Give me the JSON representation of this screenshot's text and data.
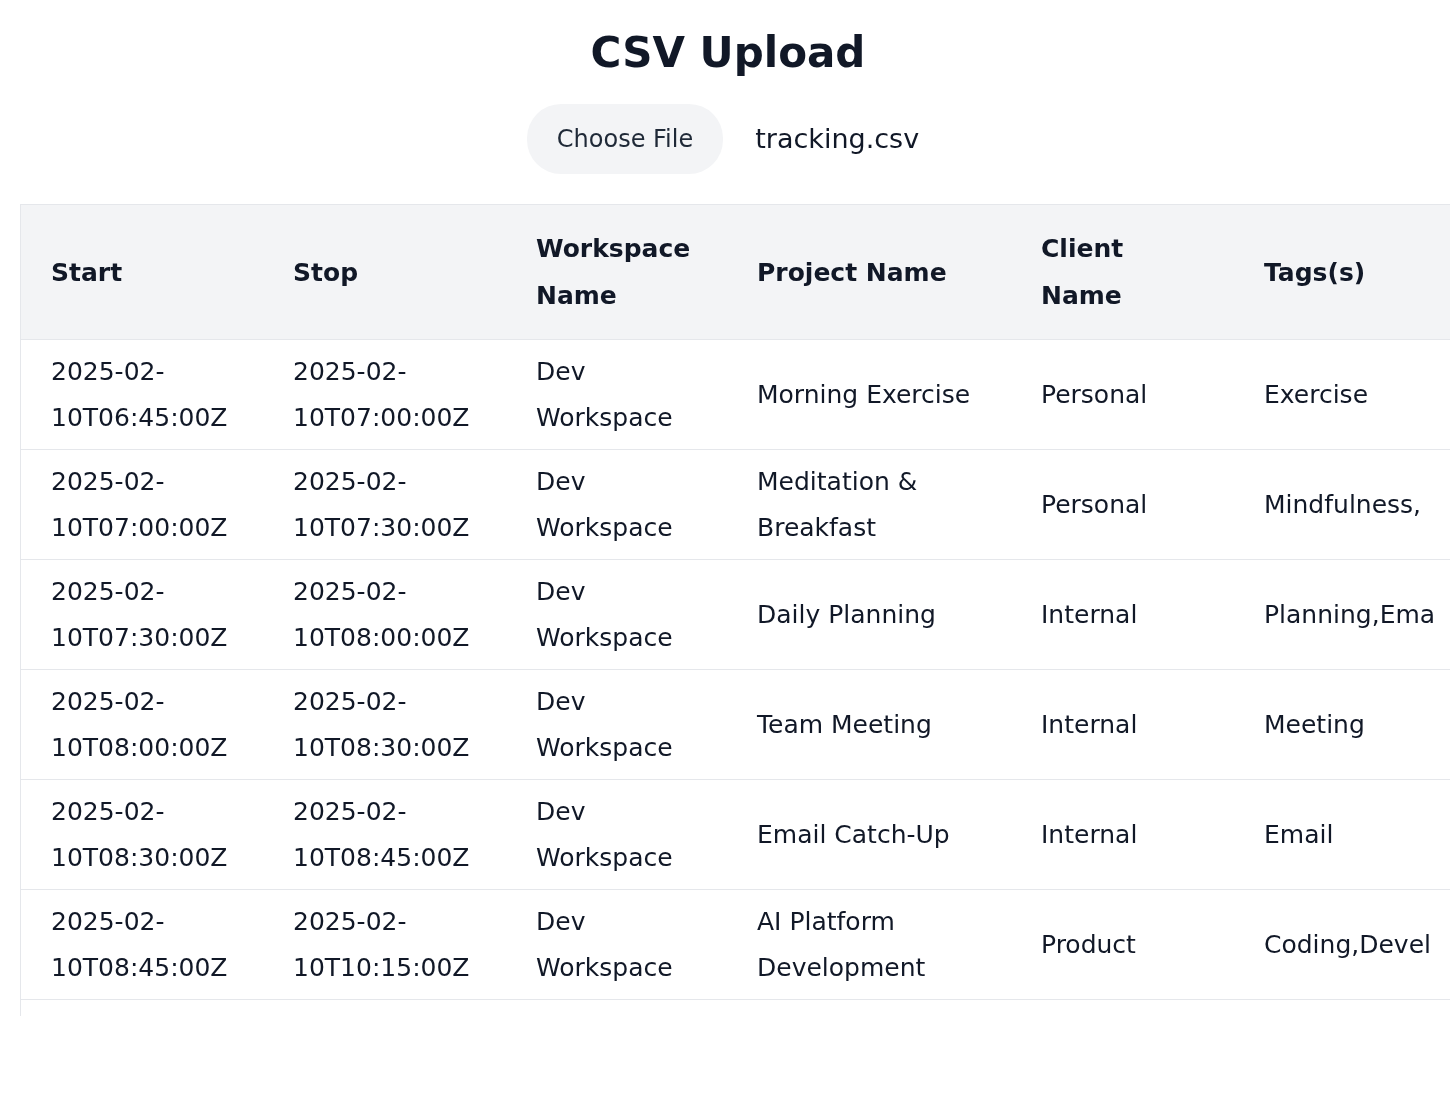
{
  "title": "CSV Upload",
  "file_input": {
    "button": "Choose File",
    "filename": "tracking.csv"
  },
  "table": {
    "columns": [
      "Start",
      "Stop",
      "Workspace Name",
      "Project Name",
      "Client Name",
      "Tags(s)"
    ],
    "rows": [
      [
        "2025-02-10T06:45:00Z",
        "2025-02-10T07:00:00Z",
        "Dev Workspace",
        "Morning Exercise",
        "Personal",
        "Exercise"
      ],
      [
        "2025-02-10T07:00:00Z",
        "2025-02-10T07:30:00Z",
        "Dev Workspace",
        "Meditation & Breakfast",
        "Personal",
        "Mindfulness,"
      ],
      [
        "2025-02-10T07:30:00Z",
        "2025-02-10T08:00:00Z",
        "Dev Workspace",
        "Daily Planning",
        "Internal",
        "Planning,Ema"
      ],
      [
        "2025-02-10T08:00:00Z",
        "2025-02-10T08:30:00Z",
        "Dev Workspace",
        "Team Meeting",
        "Internal",
        "Meeting"
      ],
      [
        "2025-02-10T08:30:00Z",
        "2025-02-10T08:45:00Z",
        "Dev Workspace",
        "Email Catch-Up",
        "Internal",
        "Email"
      ],
      [
        "2025-02-10T08:45:00Z",
        "2025-02-10T10:15:00Z",
        "Dev Workspace",
        "AI Platform Development",
        "Product",
        "Coding,Devel"
      ]
    ]
  }
}
